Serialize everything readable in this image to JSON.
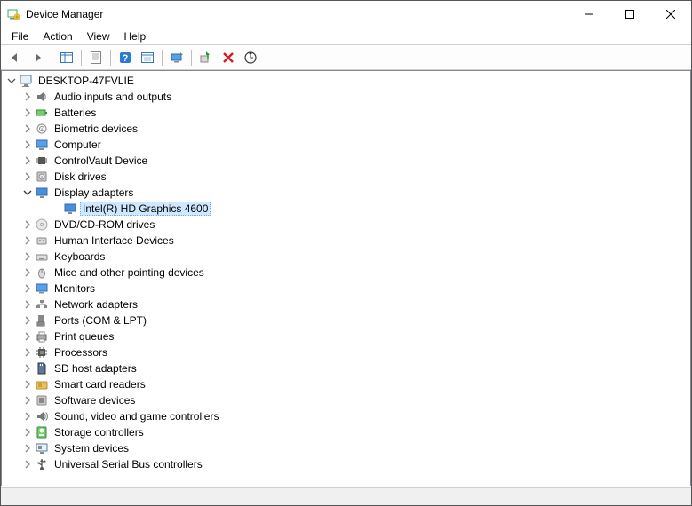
{
  "window": {
    "title": "Device Manager"
  },
  "menu": {
    "file": "File",
    "action": "Action",
    "view": "View",
    "help": "Help"
  },
  "tree": {
    "root": "DESKTOP-47FVLIE",
    "items": [
      {
        "label": "Audio inputs and outputs",
        "icon": "audio"
      },
      {
        "label": "Batteries",
        "icon": "battery"
      },
      {
        "label": "Biometric devices",
        "icon": "biometric"
      },
      {
        "label": "Computer",
        "icon": "computer"
      },
      {
        "label": "ControlVault Device",
        "icon": "chip"
      },
      {
        "label": "Disk drives",
        "icon": "disk"
      },
      {
        "label": "Display adapters",
        "icon": "display",
        "expanded": true,
        "children": [
          {
            "label": "Intel(R) HD Graphics 4600",
            "icon": "display",
            "selected": true
          }
        ]
      },
      {
        "label": "DVD/CD-ROM drives",
        "icon": "dvd"
      },
      {
        "label": "Human Interface Devices",
        "icon": "hid"
      },
      {
        "label": "Keyboards",
        "icon": "keyboard"
      },
      {
        "label": "Mice and other pointing devices",
        "icon": "mouse"
      },
      {
        "label": "Monitors",
        "icon": "monitor"
      },
      {
        "label": "Network adapters",
        "icon": "network"
      },
      {
        "label": "Ports (COM & LPT)",
        "icon": "port"
      },
      {
        "label": "Print queues",
        "icon": "printer"
      },
      {
        "label": "Processors",
        "icon": "processor"
      },
      {
        "label": "SD host adapters",
        "icon": "sd"
      },
      {
        "label": "Smart card readers",
        "icon": "smartcard"
      },
      {
        "label": "Software devices",
        "icon": "software"
      },
      {
        "label": "Sound, video and game controllers",
        "icon": "sound"
      },
      {
        "label": "Storage controllers",
        "icon": "storage"
      },
      {
        "label": "System devices",
        "icon": "system"
      },
      {
        "label": "Universal Serial Bus controllers",
        "icon": "usb"
      }
    ]
  }
}
